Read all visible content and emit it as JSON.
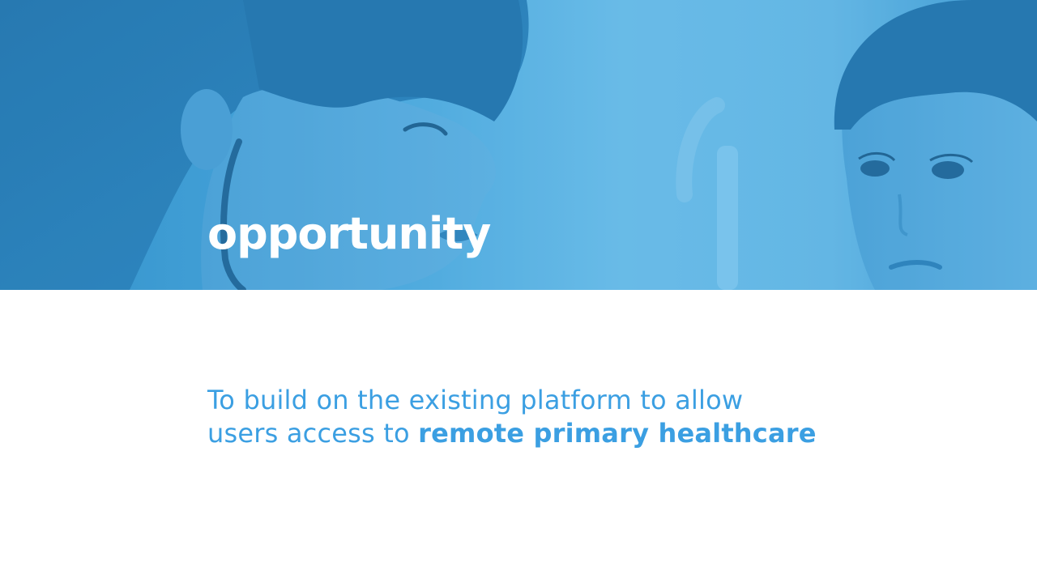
{
  "slide": {
    "title": "opportunity",
    "statement": {
      "line1": "To build on the existing platform to allow",
      "line2_prefix": "users access to ",
      "line2_emphasis": "remote primary healthcare"
    },
    "hero_image": {
      "subject": "doctor-with-stethoscope-and-child",
      "tint_color": "#4aa7dc"
    },
    "text_color": "#3b9fe2"
  }
}
